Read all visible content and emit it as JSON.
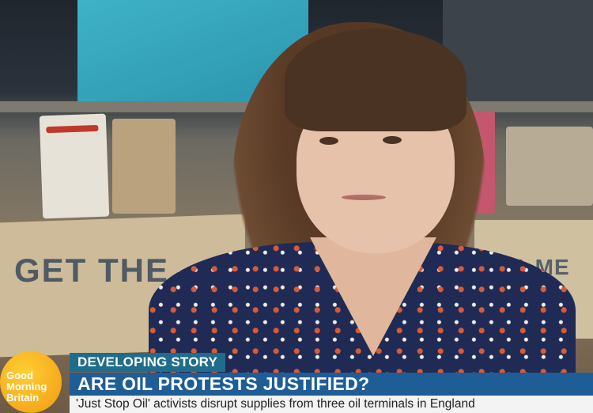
{
  "background": {
    "placard_left_text": "GET THE",
    "placard_right_text": "ETA ME"
  },
  "logo": {
    "lines": [
      "Good",
      "Morning",
      "Britain"
    ],
    "color": "#f6b21b"
  },
  "lower_third": {
    "tag": "DEVELOPING STORY",
    "headline": "ARE OIL PROTESTS JUSTIFIED?",
    "subline": "'Just Stop Oil' activists disrupt supplies from three oil terminals in England",
    "colors": {
      "tag": "#1f6d8a",
      "headline": "#1f5d97",
      "subline_bg": "#f3f3f3"
    }
  }
}
